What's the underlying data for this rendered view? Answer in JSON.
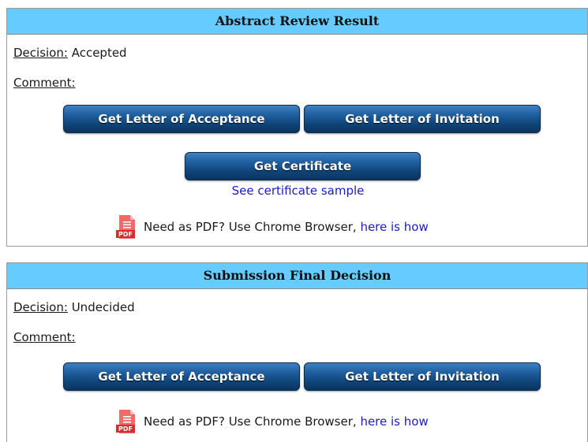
{
  "review": {
    "title": "Abstract Review Result",
    "decision_label": "Decision:",
    "decision_value": "Accepted",
    "comment_label": "Comment:",
    "acceptance_button": "Get Letter of Acceptance",
    "invitation_button": "Get Letter of Invitation",
    "certificate_button": "Get Certificate",
    "certificate_sample_link": "See certificate sample",
    "pdf_text": "Need as PDF? Use Chrome Browser,",
    "pdf_link": "here is how",
    "pdf_icon_text": "PDF"
  },
  "final": {
    "title": "Submission Final Decision",
    "decision_label": "Decision:",
    "decision_value": "Undecided",
    "comment_label": "Comment:",
    "acceptance_button": "Get Letter of Acceptance",
    "invitation_button": "Get Letter of Invitation",
    "pdf_text": "Need as PDF? Use Chrome Browser,",
    "pdf_link": "here is how",
    "pdf_icon_text": "PDF"
  },
  "colors": {
    "header_bg": "#66ccff",
    "button_dark": "#0f4478",
    "link": "#1a1acc",
    "pdf_red": "#e53b3b"
  }
}
